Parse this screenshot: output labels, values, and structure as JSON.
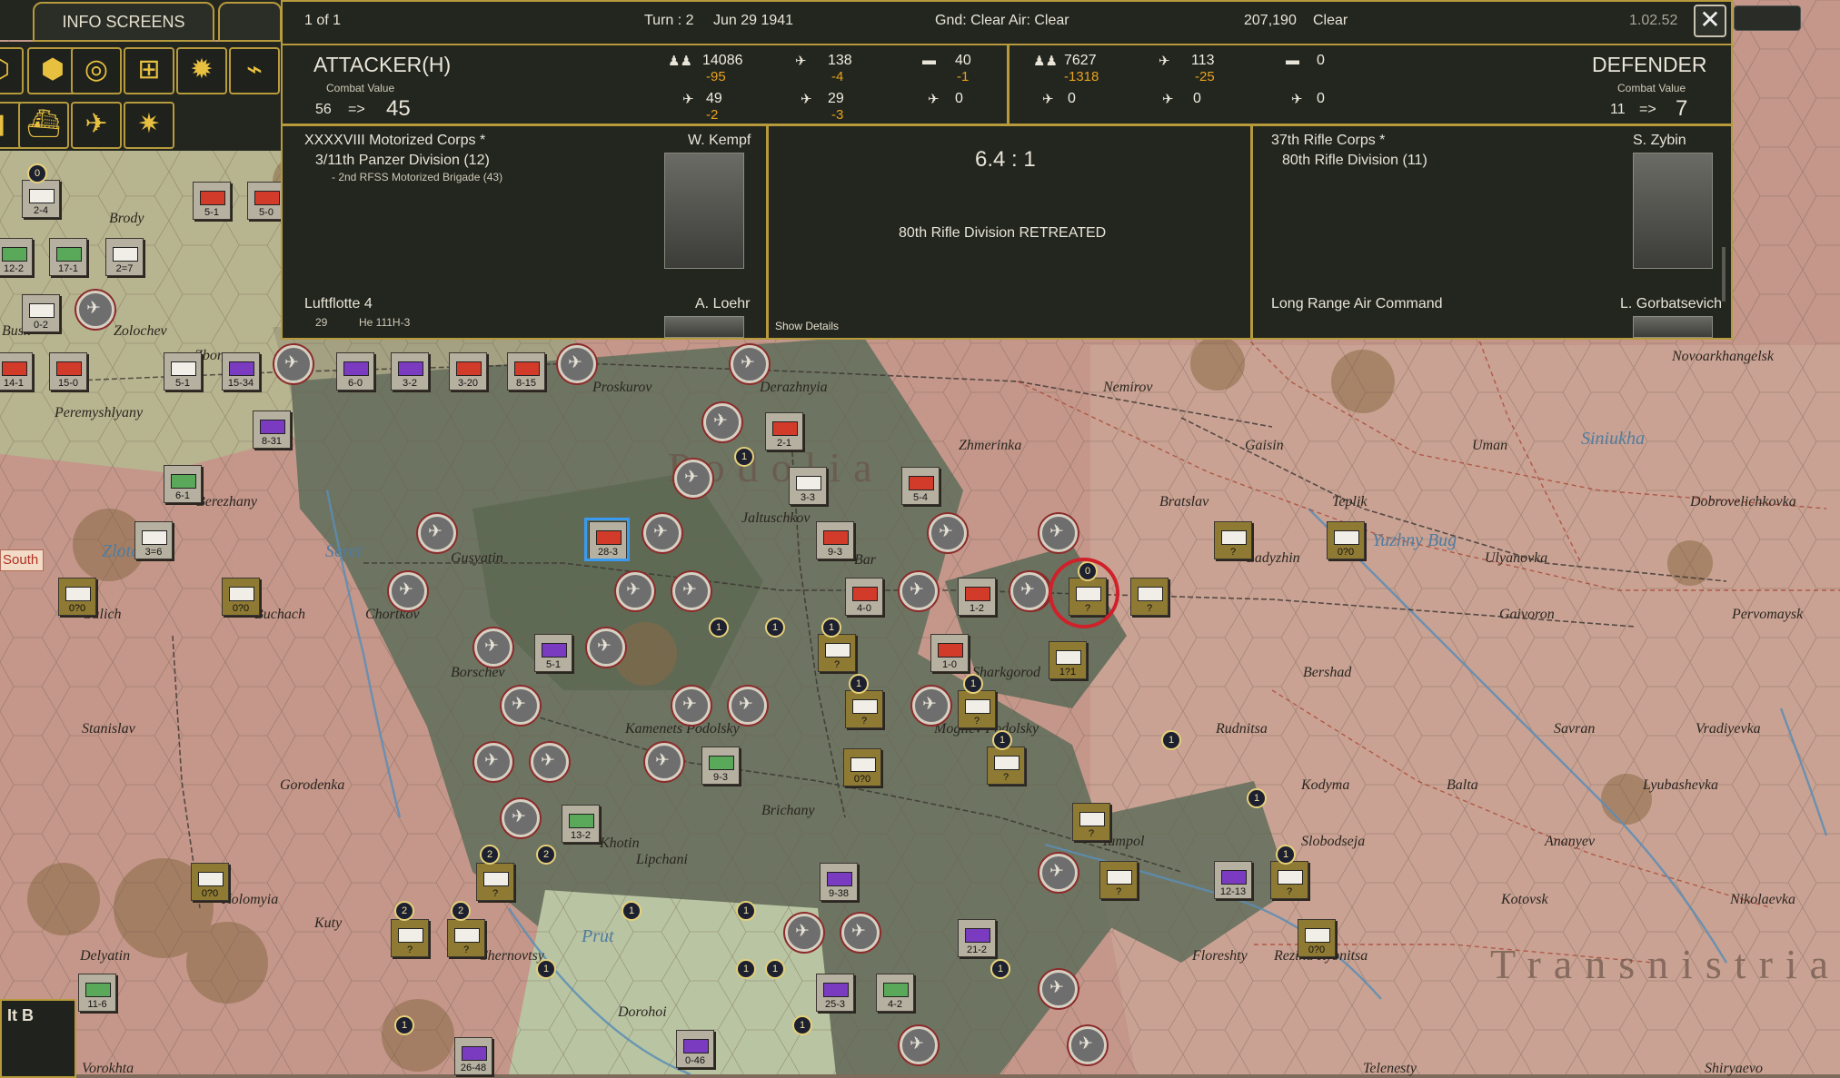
{
  "header": {
    "tab_label": "INFO SCREENS",
    "toolbar_row1_keys": [
      "E",
      "F",
      "R",
      "D",
      "L"
    ],
    "toolbar_row2_keys": [
      "F4",
      "F5",
      "F11"
    ]
  },
  "combat": {
    "page_indicator": "1 of 1",
    "turn": "Turn : 2",
    "date": "Jun 29 1941",
    "weather": "Gnd: Clear  Air: Clear",
    "location_code": "207,190",
    "terrain": "Clear",
    "version": "1.02.52",
    "close_label": "✕",
    "attacker": {
      "title": "ATTACKER(H)",
      "cv_label": "Combat Value",
      "cv_from": "56",
      "cv_arrow": "=>",
      "cv_to": "45",
      "men": "14086",
      "men_loss": "-95",
      "fighters": "138",
      "fighters_loss": "-4",
      "tanks": "40",
      "tanks_loss": "-1",
      "planes_a": "49",
      "planes_a_loss": "-2",
      "planes_b": "29",
      "planes_b_loss": "-3",
      "planes_c": "0",
      "hq": "XXXXVIII Motorized Corps *",
      "division": "3/11th Panzer Division (12)",
      "brigade": "- 2nd RFSS Motorized Brigade (43)",
      "commander": "W. Kempf",
      "air_hq": "Luftflotte 4",
      "air_commander": "A. Loehr",
      "air_count": "29",
      "air_type": "He 111H-3"
    },
    "result": {
      "odds": "6.4 : 1",
      "message": "80th Rifle Division RETREATED",
      "details_link": "Show Details"
    },
    "defender": {
      "title": "DEFENDER",
      "cv_label": "Combat Value",
      "cv_from": "11",
      "cv_arrow": "=>",
      "cv_to": "7",
      "men": "7627",
      "men_loss": "-1318",
      "fighters": "113",
      "fighters_loss": "-25",
      "tanks": "0",
      "planes_a": "0",
      "planes_b": "0",
      "planes_c": "0",
      "hq": "37th Rifle Corps *",
      "division": "80th Rifle Division (11)",
      "commander": "S. Zybin",
      "air_hq": "Long Range Air Command",
      "air_commander": "L. Gorbatsevich"
    }
  },
  "map": {
    "south_tag": "South",
    "minimap_label": "It B",
    "regions": [
      "Podolia",
      "Transnistria"
    ],
    "rivers": [
      "Seret",
      "Prut",
      "Yuzhny Bug",
      "Siniukha",
      "Zlota"
    ],
    "cities": [
      "Brody",
      "Zolochev",
      "Busk",
      "Zborov",
      "Proskurov",
      "Derazhnyia",
      "Nemirov",
      "Gaisin",
      "Uman",
      "Novoarkhangelsk",
      "Zhmerinka",
      "Bratslav",
      "Teplik",
      "Dobrovelichkovka",
      "Gusyatin",
      "Jaltuschkov",
      "Bar",
      "Chortkov",
      "Buchach",
      "Galich",
      "Stanislav",
      "Borschev",
      "Kamenets Podolsky",
      "Mogilev Podolsky",
      "Bershad",
      "Rudnitsa",
      "Savran",
      "Vradiyevka",
      "Gaivoron",
      "Pervomaysk",
      "Ulyanovka",
      "Ladyzhin",
      "Kodyma",
      "Balta",
      "Lyubashevka",
      "Slobodseja",
      "Ananyev",
      "Kotovsk",
      "Nikolaevka",
      "Floreshty",
      "Rezina Rybnitsa",
      "Yampol",
      "Gorodenka",
      "Kolomyia",
      "Kuty",
      "Delyatin",
      "Chernovtsy",
      "Lipchani",
      "Brichany",
      "Khotin",
      "Sharkgorod",
      "Berezhany",
      "Peremyshlyany",
      "Vorokhta",
      "Dorohoi",
      "Telenesty",
      "Shiryaevo"
    ],
    "unit_labels": [
      "2-4",
      "12-2",
      "17-1",
      "2=7",
      "5-1",
      "5-0",
      "0-2",
      "3-0",
      "14-1",
      "15-0",
      "5-1",
      "15-34",
      "6-0",
      "3-2",
      "3-20",
      "8-15",
      "8-31",
      "6-1",
      "3=6",
      "0?0",
      "0?0",
      "2-1",
      "3-3",
      "5-4",
      "28-3",
      "9-3",
      "4-0",
      "1-2",
      "2-2",
      "1-0",
      "5-1",
      "9-3",
      "13-2",
      "0?0",
      "9-38",
      "21-2",
      "25-3",
      "4-2",
      "1=1",
      "4-0",
      "0-46",
      "26-48",
      "11-6",
      "12-13",
      "0?0",
      "0?0",
      "1?1",
      "?"
    ]
  }
}
